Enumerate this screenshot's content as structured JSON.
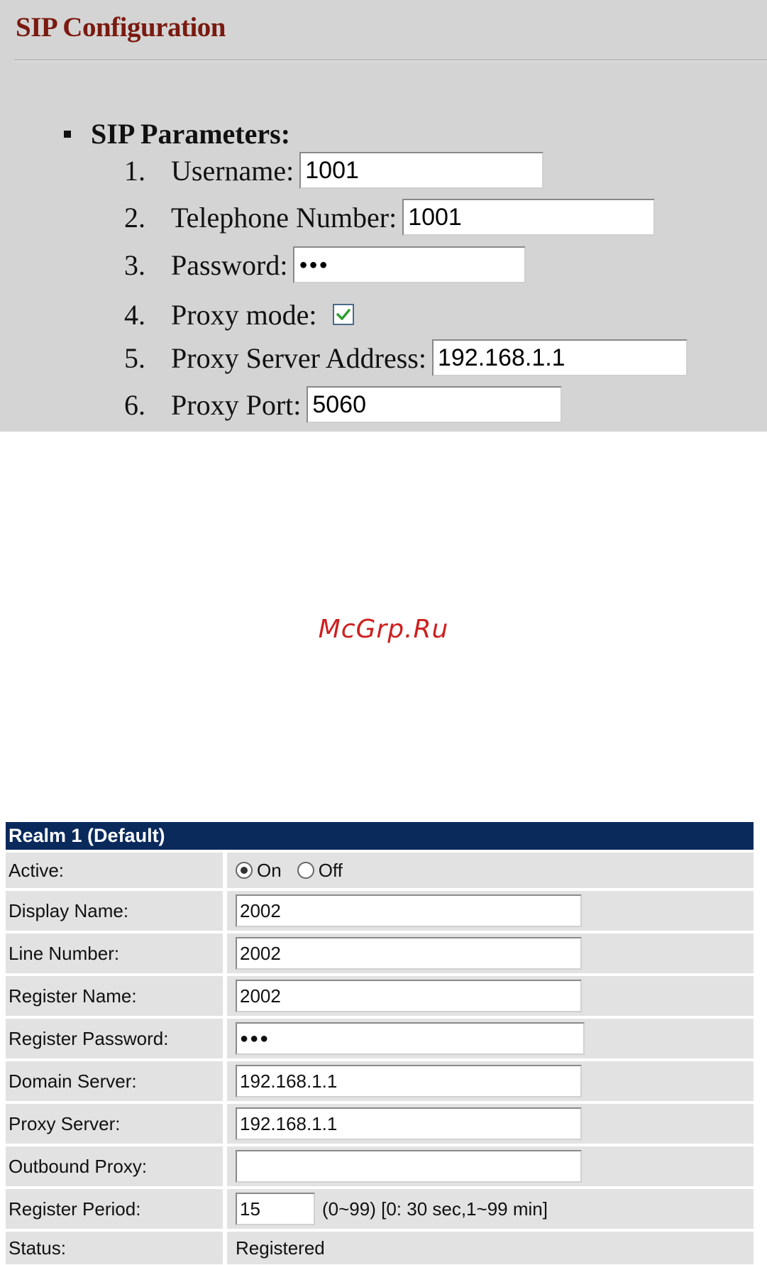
{
  "sip": {
    "title": "SIP Configuration",
    "section": "SIP Parameters:",
    "items": [
      {
        "num": "1.",
        "label": "Username:",
        "value": "1001"
      },
      {
        "num": "2.",
        "label": "Telephone Number:",
        "value": "1001"
      },
      {
        "num": "3.",
        "label": "Password:",
        "value": "●●●"
      },
      {
        "num": "4.",
        "label": "Proxy mode:",
        "checked": true
      },
      {
        "num": "5.",
        "label": "Proxy Server Address:",
        "value": "192.168.1.1"
      },
      {
        "num": "6.",
        "label": "Proxy Port:",
        "value": "5060"
      }
    ],
    "colors": {
      "title": "#7a1a10",
      "panel": "#d4d4d4",
      "checkmark": "#2e9e2e"
    }
  },
  "watermark": "McGrp.Ru",
  "realm": {
    "header": "Realm 1 (Default)",
    "rows": [
      {
        "label": "Active:",
        "options": [
          "On",
          "Off"
        ],
        "selected": "On"
      },
      {
        "label": "Display Name:",
        "value": "2002"
      },
      {
        "label": "Line Number:",
        "value": "2002"
      },
      {
        "label": "Register Name:",
        "value": "2002"
      },
      {
        "label": "Register Password:",
        "value": "●●●"
      },
      {
        "label": "Domain Server:",
        "value": "192.168.1.1"
      },
      {
        "label": "Proxy Server:",
        "value": "192.168.1.1"
      },
      {
        "label": "Outbound Proxy:",
        "value": ""
      },
      {
        "label": "Register Period:",
        "value": "15",
        "hint": "(0~99) [0: 30 sec,1~99 min]"
      },
      {
        "label": "Status:",
        "value": "Registered"
      }
    ],
    "colors": {
      "header": "#0a2a5c",
      "row": "#e2e2e2"
    }
  }
}
